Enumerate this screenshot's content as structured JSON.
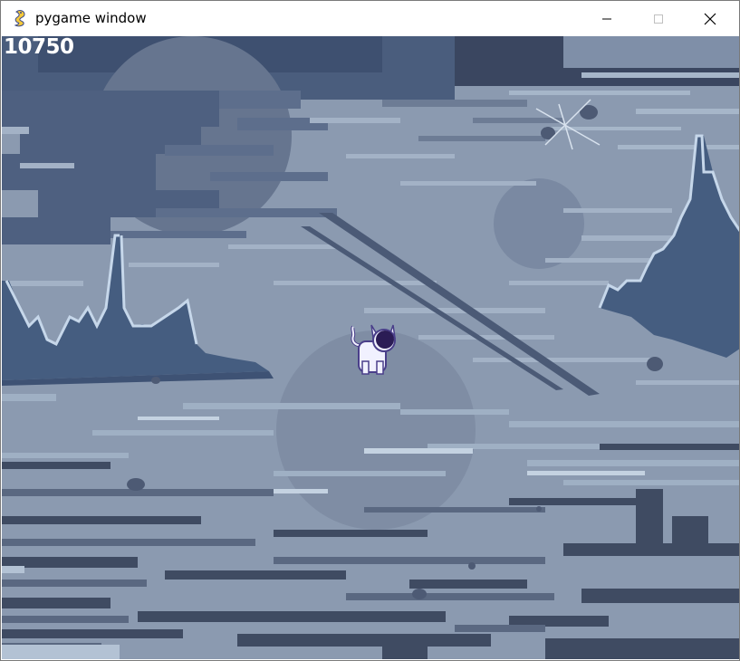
{
  "window": {
    "title": "pygame window",
    "icon": "pygame-snake-icon",
    "controls": {
      "minimize": "minimize-icon",
      "maximize": "maximize-icon",
      "close": "close-icon"
    }
  },
  "hud": {
    "score": "10750"
  },
  "scene": {
    "player": "white-cat",
    "palette": {
      "sky_dark": "#394a66",
      "mountain": "#455d80",
      "mid": "#6f7e96",
      "light": "#a6b6c9",
      "pale": "#c6d3e1",
      "ground_dark": "#3e4a60",
      "cat_body": "#f1f1ff",
      "cat_outline": "#4a3f8a",
      "cat_face": "#2b1c55"
    }
  }
}
